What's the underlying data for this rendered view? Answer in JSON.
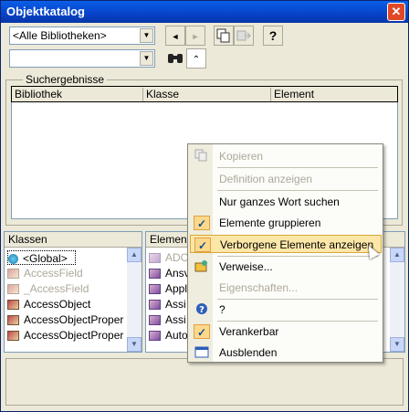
{
  "window": {
    "title": "Objektkatalog",
    "close_glyph": "✕"
  },
  "toolbar": {
    "library_combo": "<Alle Bibliotheken>",
    "search_combo": "",
    "btn_back": "◄",
    "btn_forward": "►",
    "btn_copy": "copy-icon",
    "btn_view_def": "view-definition-icon",
    "btn_help": "?",
    "btn_search": "binoculars-icon",
    "btn_toggle": "double-chevron-up-icon"
  },
  "search_results": {
    "legend": "Suchergebnisse",
    "columns": [
      "Bibliothek",
      "Klasse",
      "Element"
    ]
  },
  "classes_pane": {
    "header": "Klassen",
    "items": [
      {
        "label": "<Global>",
        "icon": "globe-icon",
        "grey": false
      },
      {
        "label": "AccessField",
        "icon": "class-icon",
        "grey": true
      },
      {
        "label": "_AccessField",
        "icon": "class-icon",
        "grey": true
      },
      {
        "label": "AccessObject",
        "icon": "class-icon",
        "grey": false
      },
      {
        "label": "AccessObjectProper",
        "icon": "class-icon",
        "grey": false
      },
      {
        "label": "AccessObjectProper",
        "icon": "class-icon",
        "grey": false
      }
    ]
  },
  "members_pane": {
    "header": "Elemen",
    "items": [
      {
        "label": "ADO",
        "grey": true
      },
      {
        "label": "Ansv",
        "grey": false
      },
      {
        "label": "Appl",
        "grey": false
      },
      {
        "label": "Assi",
        "grey": false
      },
      {
        "label": "Assi",
        "grey": false
      },
      {
        "label": "Auto",
        "grey": false
      }
    ]
  },
  "context_menu": {
    "items": [
      {
        "label": "Kopieren",
        "icon": "copy-icon",
        "disabled": true,
        "checked": false
      },
      {
        "label": "Definition anzeigen",
        "icon": "",
        "disabled": true,
        "checked": false
      },
      {
        "label": "Nur ganzes Wort suchen",
        "icon": "",
        "disabled": false,
        "checked": false
      },
      {
        "label": "Elemente gruppieren",
        "icon": "check-icon",
        "disabled": false,
        "checked": true
      },
      {
        "label": "Verborgene Elemente anzeigen",
        "icon": "check-icon",
        "disabled": false,
        "checked": true,
        "highlighted": true
      },
      {
        "label": "Verweise...",
        "icon": "references-icon",
        "disabled": false,
        "checked": false
      },
      {
        "label": "Eigenschaften...",
        "icon": "",
        "disabled": true,
        "checked": false
      },
      {
        "label": "?",
        "icon": "help-icon",
        "disabled": false,
        "checked": false
      },
      {
        "label": "Verankerbar",
        "icon": "check-icon",
        "disabled": false,
        "checked": true
      },
      {
        "label": "Ausblenden",
        "icon": "window-icon",
        "disabled": false,
        "checked": false
      }
    ]
  }
}
